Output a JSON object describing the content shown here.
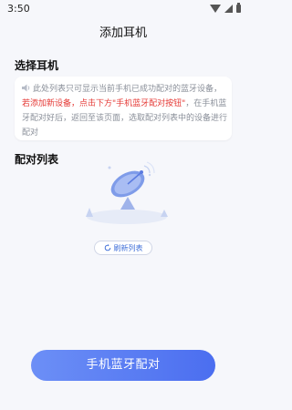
{
  "status_bar": {
    "time": "3:50"
  },
  "header": {
    "title": "添加耳机"
  },
  "sections": {
    "select_title": "选择耳机",
    "list_title": "配对列表"
  },
  "info": {
    "line_a": "此处列表只可显示当前手机已成功配对的蓝牙设备，",
    "line_b_red": "若添加新设备，点击下方\"手机蓝牙配对按钮\"",
    "line_c": "，在手机蓝牙配对好后，返回至该页面，选取配对列表中的设备进行配对"
  },
  "refresh_label": "刷新列表",
  "pair_button_label": "手机蓝牙配对",
  "icons": {
    "speaker": "speaker-icon",
    "refresh": "refresh-icon",
    "wifi": "wifi-icon",
    "signal": "signal-icon",
    "battery": "battery-icon"
  },
  "colors": {
    "accent": "#4b6ef0",
    "warning": "#e53935",
    "hint": "#8a8f99"
  }
}
